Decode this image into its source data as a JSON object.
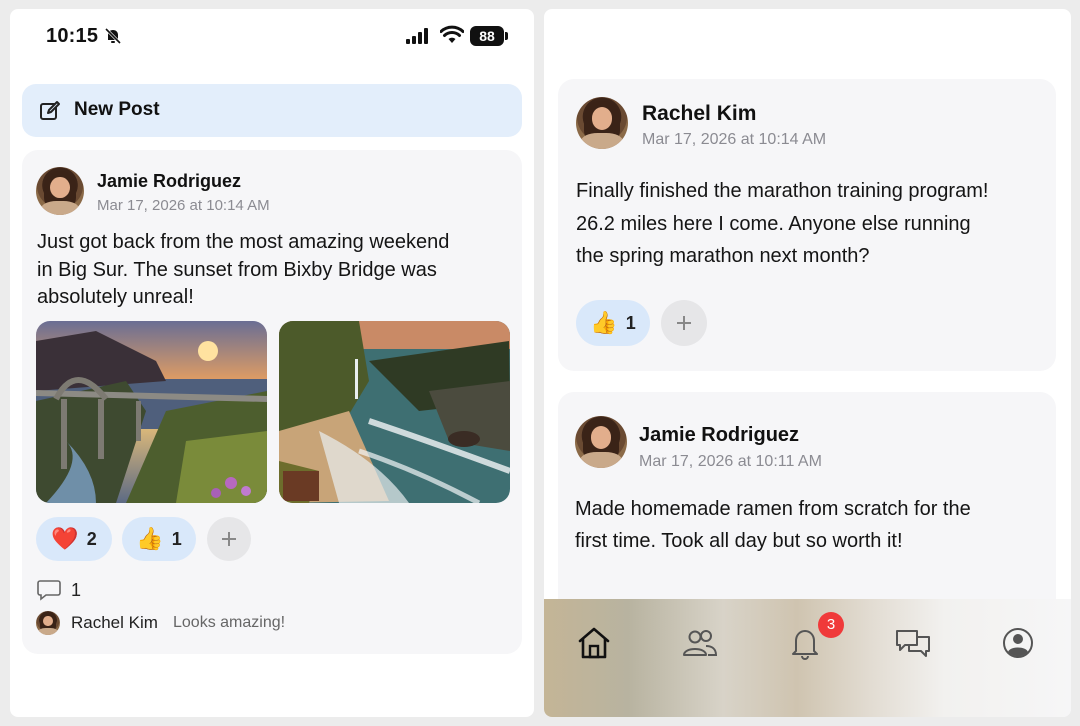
{
  "status_bar": {
    "time": "10:15",
    "battery": "88"
  },
  "new_post": {
    "label": "New Post"
  },
  "feed_left": {
    "post": {
      "author": "Jamie Rodriguez",
      "timestamp": "Mar 17, 2026 at 10:14 AM",
      "text_lines": [
        "Just got back from the most amazing weekend",
        "in Big Sur. The sunset from Bixby Bridge was",
        "absolutely unreal!"
      ],
      "reactions": [
        {
          "emoji": "❤️",
          "count": "2"
        },
        {
          "emoji": "👍",
          "count": "1"
        }
      ],
      "add_reaction": "+",
      "comment_count": "1",
      "comment": {
        "author": "Rachel Kim",
        "text": "Looks amazing!"
      }
    }
  },
  "feed_right": {
    "posts": [
      {
        "author": "Rachel Kim",
        "timestamp": "Mar 17, 2026 at 10:14 AM",
        "text_lines": [
          "Finally finished the marathon training program!",
          "26.2 miles here I come. Anyone else running",
          "the spring marathon next month?"
        ],
        "reactions": [
          {
            "emoji": "👍",
            "count": "1"
          }
        ],
        "add_reaction": "+"
      },
      {
        "author": "Jamie Rodriguez",
        "timestamp": "Mar 17, 2026 at 10:11 AM",
        "text_lines": [
          "Made homemade ramen from scratch for the",
          "first time. Took all day but so worth it!"
        ]
      }
    ]
  },
  "bottom_nav": {
    "items": [
      "home-icon",
      "friends-icon",
      "notifications-icon",
      "messages-icon",
      "profile-icon"
    ],
    "notification_badge": "3"
  },
  "colors": {
    "accent_light": "#e3eefb",
    "reaction_bg": "#d9e8fa",
    "badge": "#f03a3a"
  }
}
